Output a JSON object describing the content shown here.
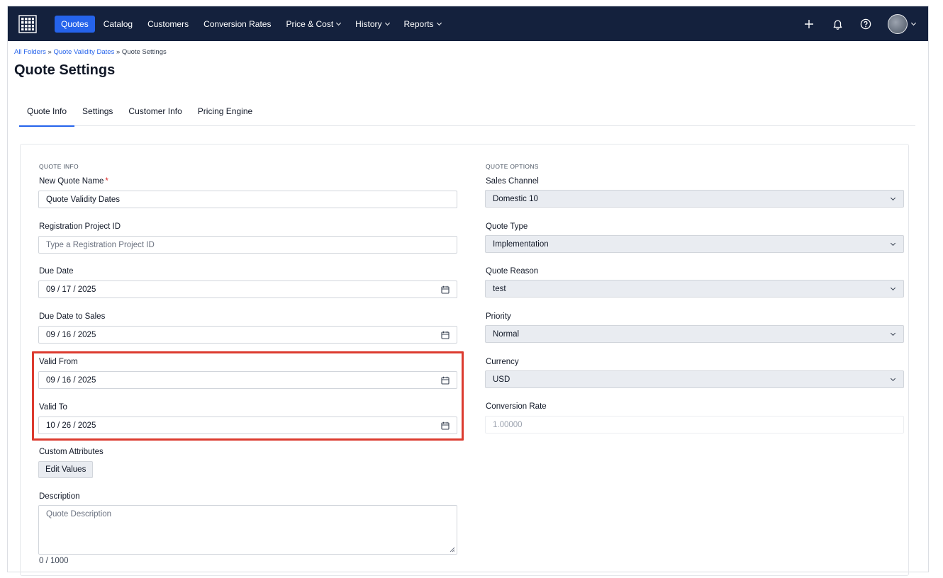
{
  "nav": {
    "items": [
      {
        "label": "Quotes",
        "active": true,
        "dropdown": false
      },
      {
        "label": "Catalog",
        "active": false,
        "dropdown": false
      },
      {
        "label": "Customers",
        "active": false,
        "dropdown": false
      },
      {
        "label": "Conversion Rates",
        "active": false,
        "dropdown": false
      },
      {
        "label": "Price & Cost",
        "active": false,
        "dropdown": true
      },
      {
        "label": "History",
        "active": false,
        "dropdown": true
      },
      {
        "label": "Reports",
        "active": false,
        "dropdown": true
      }
    ],
    "icons": [
      "grid-logo-icon",
      "plus-icon",
      "bell-icon",
      "help-icon",
      "avatar"
    ],
    "colors": {
      "bar": "#14213d",
      "active": "#2563eb"
    }
  },
  "breadcrumb": {
    "folder": "All Folders",
    "sep1": " » ",
    "parent": "Quote Validity Dates",
    "sep2": " » ",
    "current": "Quote Settings"
  },
  "page": {
    "title": "Quote Settings"
  },
  "tabs": [
    {
      "label": "Quote Info",
      "active": true
    },
    {
      "label": "Settings",
      "active": false
    },
    {
      "label": "Customer Info",
      "active": false
    },
    {
      "label": "Pricing Engine",
      "active": false
    }
  ],
  "quote_info": {
    "section": "QUOTE INFO",
    "name": {
      "label": "New Quote Name",
      "required_mark": "*",
      "value": "Quote Validity Dates"
    },
    "registration": {
      "label": "Registration Project ID",
      "placeholder": "Type a Registration Project ID"
    },
    "due_date": {
      "label": "Due Date",
      "value": "09 / 17 / 2025"
    },
    "due_date_sales": {
      "label": "Due Date to Sales",
      "value": "09 / 16 / 2025"
    },
    "valid_from": {
      "label": "Valid From",
      "value": "09 / 16 / 2025"
    },
    "valid_to": {
      "label": "Valid To",
      "value": "10 / 26 / 2025"
    },
    "custom_attributes": {
      "label": "Custom Attributes",
      "button": "Edit Values"
    },
    "description": {
      "label": "Description",
      "placeholder": "Quote Description",
      "counter": "0 / 1000"
    }
  },
  "quote_options": {
    "section": "QUOTE OPTIONS",
    "sales_channel": {
      "label": "Sales Channel",
      "value": "Domestic 10"
    },
    "quote_type": {
      "label": "Quote Type",
      "value": "Implementation"
    },
    "quote_reason": {
      "label": "Quote Reason",
      "value": "test"
    },
    "priority": {
      "label": "Priority",
      "value": "Normal"
    },
    "currency": {
      "label": "Currency",
      "value": "USD"
    },
    "conversion_rate": {
      "label": "Conversion Rate",
      "value": "1.00000"
    }
  },
  "highlight_color": "#dc3b2f"
}
